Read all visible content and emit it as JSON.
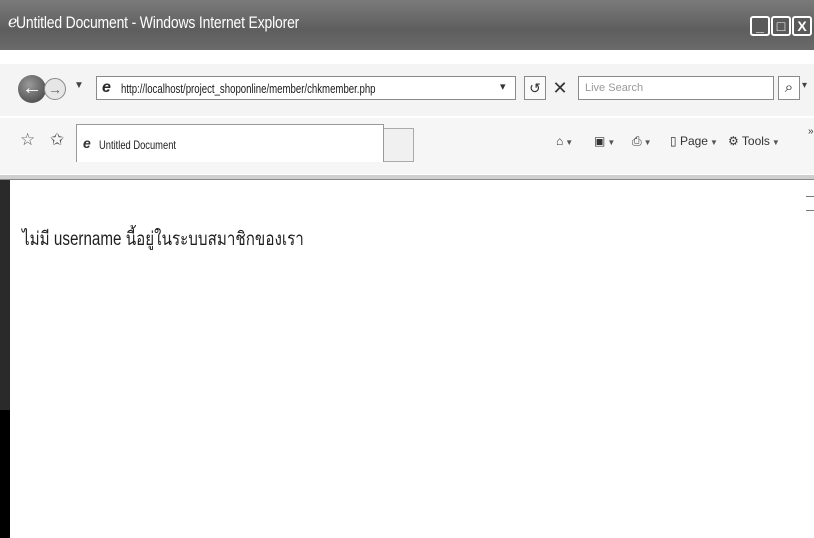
{
  "window": {
    "title": "Untitled Document - Windows Internet Explorer",
    "minimize_glyph": "_",
    "maximize_glyph": "□",
    "close_glyph": "X"
  },
  "navigation": {
    "back_glyph": "←",
    "forward_glyph": "→",
    "address_url": "http://localhost/project_shoponline/member/chkmember.php",
    "search_placeholder": "Live Search",
    "refresh_glyph": "↺",
    "stop_glyph": "✕",
    "search_glyph": "⌕"
  },
  "tabs": [
    {
      "label": "Untitled Document",
      "active": true
    }
  ],
  "command_bar": {
    "home_glyph": "⌂",
    "feeds_glyph": "▣",
    "print_glyph": "⎙",
    "page_label": "Page",
    "tools_label": "Tools"
  },
  "page": {
    "message": "ไม่มี username นี้อยู่ในระบบสมาชิกของเรา"
  },
  "icons": {
    "browser": "ie-logo-icon",
    "favorites": "star-icon",
    "add_favorite": "add-favorite-icon",
    "page_icon": "ie-page-icon"
  },
  "colors": {
    "titlebar": "#5e5e5e",
    "chrome": "#f4f4f4",
    "text": "#1f1f1f"
  }
}
